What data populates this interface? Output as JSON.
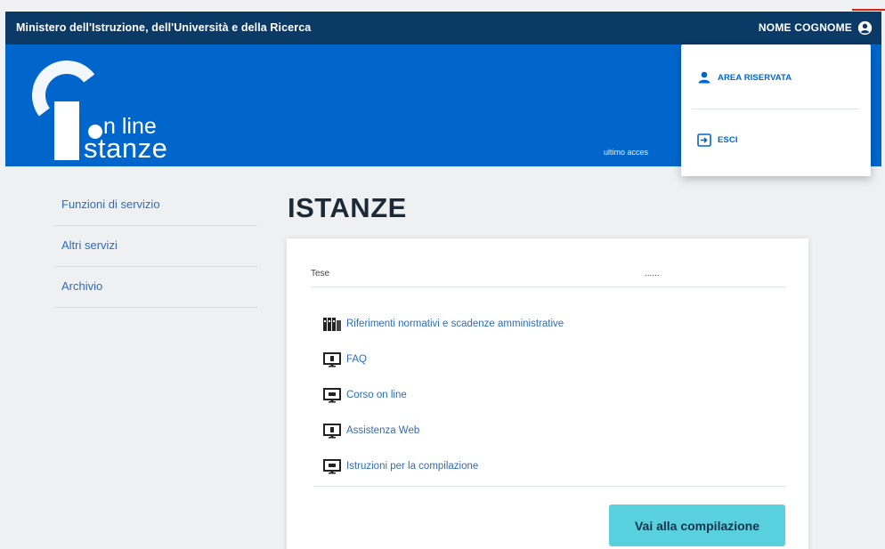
{
  "header": {
    "ministry": "Ministero dell'Istruzione, dell'Università e della Ricerca",
    "user_name": "NOME COGNOME",
    "user_icon": "user-circle-icon"
  },
  "banner": {
    "logo_line1": "n line",
    "logo_line2": "stanze",
    "last_access": "ultimo acces"
  },
  "user_menu": {
    "items": [
      {
        "label": "AREA RISERVATA",
        "icon": "person-icon"
      },
      {
        "label": "ESCI",
        "icon": "logout-icon"
      }
    ]
  },
  "sidebar": {
    "items": [
      {
        "label": "Funzioni di servizio"
      },
      {
        "label": "Altri servizi"
      },
      {
        "label": "Archivio"
      }
    ]
  },
  "main": {
    "title": "ISTANZE",
    "head_col1": "Tese",
    "head_col2": "......",
    "links": [
      {
        "label": "Riferimenti normativi e scadenze amministrative",
        "icon": "binders-icon"
      },
      {
        "label": "FAQ",
        "icon": "monitor-icon"
      },
      {
        "label": "Corso on line",
        "icon": "monitor-icon"
      },
      {
        "label": "Assistenza Web",
        "icon": "monitor-icon"
      },
      {
        "label": "Istruzioni per la compilazione",
        "icon": "monitor-icon"
      }
    ],
    "cta_label": "Vai alla compilazione"
  },
  "colors": {
    "topbar": "#0b3a66",
    "banner": "#0066cc",
    "link": "#2d6cb8",
    "cta": "#59d0dd"
  }
}
